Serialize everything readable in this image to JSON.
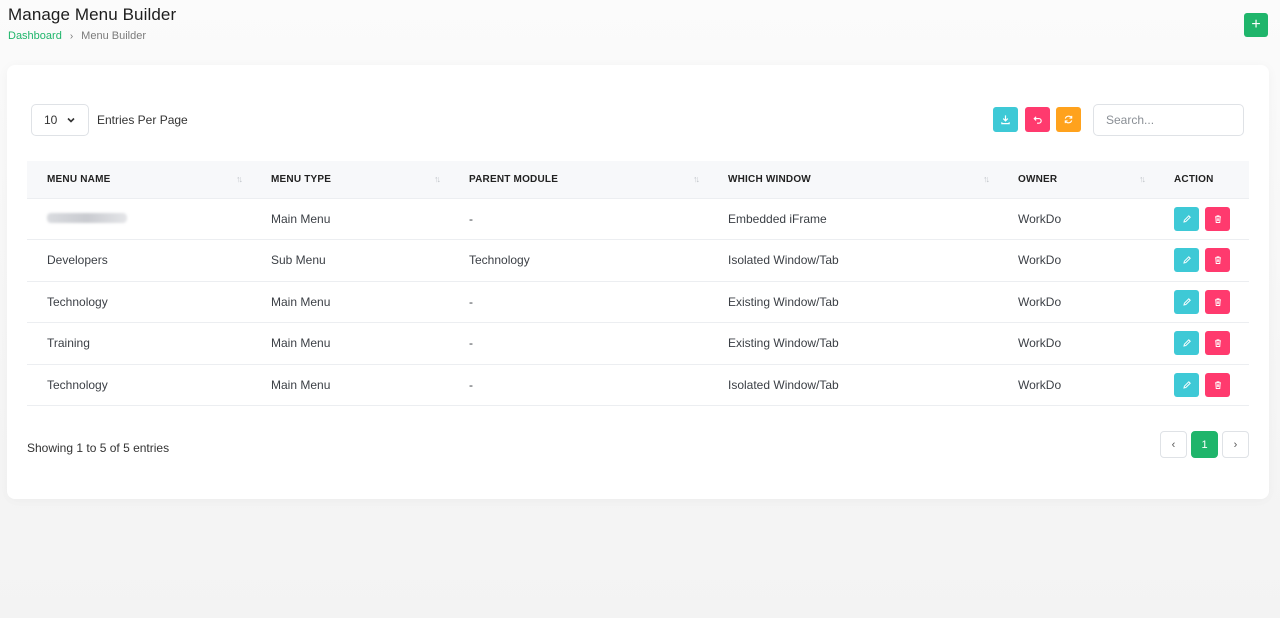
{
  "header": {
    "title": "Manage Menu Builder",
    "breadcrumb": {
      "link": "Dashboard",
      "current": "Menu Builder"
    },
    "add_icon": "plus-icon"
  },
  "toolbar": {
    "entries_value": "10",
    "entries_label": "Entries Per Page",
    "search_placeholder": "Search...",
    "buttons": [
      {
        "name": "export-button",
        "icon": "download-icon",
        "color": "#3ec9d6"
      },
      {
        "name": "reset-button",
        "icon": "undo-icon",
        "color": "#ff3a6e"
      },
      {
        "name": "reload-button",
        "icon": "refresh-icon",
        "color": "#ffa21d"
      }
    ]
  },
  "table": {
    "columns": [
      "Menu Name",
      "Menu Type",
      "Parent Module",
      "Which Window",
      "Owner",
      "Action"
    ],
    "rows": [
      {
        "menu_name": "",
        "menu_type": "Main Menu",
        "parent": "-",
        "window": "Embedded iFrame",
        "owner": "WorkDo"
      },
      {
        "menu_name": "Developers",
        "menu_type": "Sub Menu",
        "parent": "Technology",
        "window": "Isolated Window/Tab",
        "owner": "WorkDo"
      },
      {
        "menu_name": "Technology",
        "menu_type": "Main Menu",
        "parent": "-",
        "window": "Existing Window/Tab",
        "owner": "WorkDo"
      },
      {
        "menu_name": "Training",
        "menu_type": "Main Menu",
        "parent": "-",
        "window": "Existing Window/Tab",
        "owner": "WorkDo"
      },
      {
        "menu_name": "Technology",
        "menu_type": "Main Menu",
        "parent": "-",
        "window": "Isolated Window/Tab",
        "owner": "WorkDo"
      }
    ]
  },
  "footer": {
    "showing": "Showing 1 to 5 of 5 entries",
    "current_page": "1"
  },
  "colors": {
    "primary": "#1fb56b",
    "edit": "#3ec9d6",
    "delete": "#ff3a6e",
    "warning": "#ffa21d"
  }
}
